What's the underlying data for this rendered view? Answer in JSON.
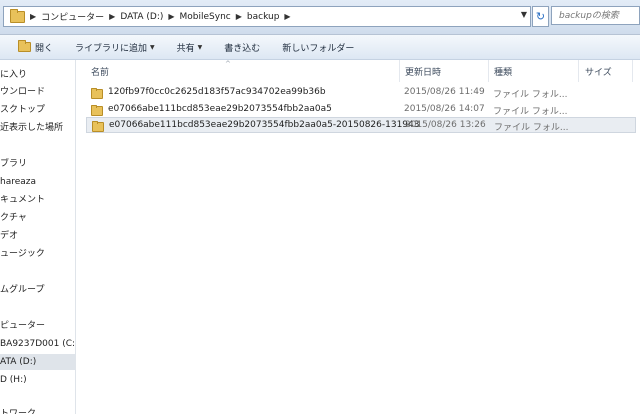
{
  "address": {
    "crumbs": [
      "コンピューター",
      "DATA (D:)",
      "MobileSync",
      "backup"
    ],
    "search_placeholder": "backupの検索"
  },
  "toolbar": {
    "open": "開く",
    "add_to_library": "ライブラリに追加",
    "share": "共有",
    "burn": "書き込む",
    "new_folder": "新しいフォルダー"
  },
  "nav": {
    "items": [
      "に入り",
      "ウンロード",
      "スクトップ",
      "近表示した場所",
      "ブラリ",
      "hareaza",
      "キュメント",
      "クチャ",
      "デオ",
      "ュージック",
      "ムグループ",
      "ピューター",
      "BA9237D001 (C:)",
      "ATA (D:)",
      "D (H:)",
      "トワーク"
    ]
  },
  "columns": {
    "name": "名前",
    "date": "更新日時",
    "type": "種類",
    "size": "サイズ"
  },
  "files": [
    {
      "name": "120fb97f0cc0c2625d183f57ac934702ea99b36b",
      "date": "2015/08/26 11:49",
      "type": "ファイル フォル..."
    },
    {
      "name": "e07066abe111bcd853eae29b2073554fbb2aa0a5",
      "date": "2015/08/26 14:07",
      "type": "ファイル フォル..."
    },
    {
      "name": "e07066abe111bcd853eae29b2073554fbb2aa0a5-20150826-131943",
      "date": "2015/08/26 13:26",
      "type": "ファイル フォル..."
    }
  ]
}
